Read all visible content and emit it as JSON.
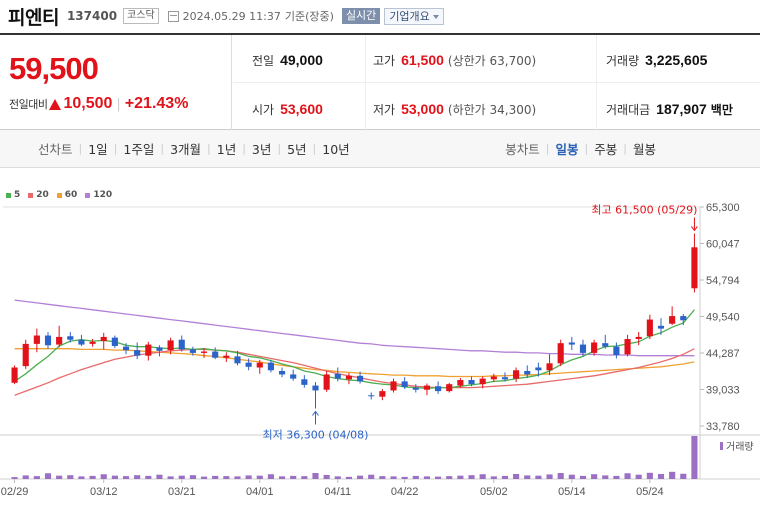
{
  "stock": {
    "name": "피엔티",
    "code": "137400",
    "market": "코스닥",
    "datetime": "2024.05.29 11:37",
    "basis": "기준(장중)",
    "realtime_label": "실시간",
    "company_info_label": "기업개요"
  },
  "summary": {
    "current_price": "59,500",
    "change_label": "전일대비",
    "change_value": "10,500",
    "change_pct": "+21.43%",
    "prev_close_label": "전일",
    "prev_close": "49,000",
    "open_label": "시가",
    "open": "53,600",
    "high_label": "고가",
    "high": "61,500",
    "upper_limit": "(상한가 63,700)",
    "low_label": "저가",
    "low": "53,000",
    "lower_limit": "(하한가 34,300)",
    "volume_label": "거래량",
    "volume": "3,225,605",
    "amount_label": "거래대금",
    "amount": "187,907",
    "amount_unit": "백만"
  },
  "periods": {
    "line_chart_label": "선차트",
    "items": [
      "1일",
      "1주일",
      "3개월",
      "1년",
      "3년",
      "5년",
      "10년"
    ],
    "candle_chart_label": "봉차트",
    "candle_items": [
      "일봉",
      "주봉",
      "월봉"
    ],
    "candle_selected": "일봉"
  },
  "colors": {
    "up": "#e2121a",
    "down": "#2b63c8",
    "ma5": "#4caf50",
    "ma20": "#e86a6a",
    "ma60": "#f0a030",
    "ma120": "#b380d8",
    "volume": "#9a6fc4"
  },
  "chart_data": {
    "type": "candlestick",
    "legend": [
      {
        "name": "5",
        "color": "#4caf50"
      },
      {
        "name": "20",
        "color": "#e86a6a"
      },
      {
        "name": "60",
        "color": "#f0a030"
      },
      {
        "name": "120",
        "color": "#b380d8"
      }
    ],
    "ylim": [
      33780,
      65300
    ],
    "y_ticks": [
      "65,300",
      "60,047",
      "54,794",
      "49,540",
      "44,287",
      "39,033",
      "33,780"
    ],
    "x_ticks": [
      {
        "label": "02/29",
        "index": 0
      },
      {
        "label": "03/12",
        "index": 8
      },
      {
        "label": "03/21",
        "index": 15
      },
      {
        "label": "04/01",
        "index": 22
      },
      {
        "label": "04/11",
        "index": 29
      },
      {
        "label": "04/22",
        "index": 35
      },
      {
        "label": "05/02",
        "index": 43
      },
      {
        "label": "05/14",
        "index": 50
      },
      {
        "label": "05/24",
        "index": 57
      }
    ],
    "annotation_high": "최고 61,500 (05/29)",
    "annotation_low": "최저 36,300 (04/08)",
    "volume_label": "거래량",
    "ohlc": [
      [
        40000,
        42500,
        39800,
        42200
      ],
      [
        42400,
        46200,
        42000,
        45600
      ],
      [
        45600,
        47800,
        44400,
        46800
      ],
      [
        46800,
        47300,
        44900,
        45400
      ],
      [
        45500,
        48200,
        45100,
        46600
      ],
      [
        46700,
        47300,
        45800,
        46200
      ],
      [
        46200,
        46900,
        45300,
        45500
      ],
      [
        45600,
        46300,
        45200,
        45900
      ],
      [
        46000,
        47200,
        44800,
        46600
      ],
      [
        46500,
        46800,
        45000,
        45300
      ],
      [
        45200,
        45700,
        44100,
        44700
      ],
      [
        44700,
        45800,
        43400,
        43900
      ],
      [
        43900,
        45900,
        43200,
        45500
      ],
      [
        45100,
        45400,
        43800,
        44600
      ],
      [
        44700,
        46500,
        44100,
        46100
      ],
      [
        46200,
        46800,
        44500,
        44800
      ],
      [
        44800,
        45200,
        43900,
        44300
      ],
      [
        44300,
        45000,
        43600,
        44500
      ],
      [
        44500,
        45100,
        43400,
        43600
      ],
      [
        43600,
        44400,
        43000,
        43900
      ],
      [
        43800,
        44600,
        42500,
        42800
      ],
      [
        42900,
        43500,
        41800,
        42300
      ],
      [
        42200,
        43300,
        41300,
        42900
      ],
      [
        42900,
        43300,
        41500,
        41800
      ],
      [
        41700,
        42200,
        40800,
        41200
      ],
      [
        41200,
        41900,
        40300,
        40600
      ],
      [
        40500,
        41100,
        39300,
        39700
      ],
      [
        39600,
        40100,
        36300,
        38900
      ],
      [
        39000,
        41700,
        38700,
        41200
      ],
      [
        41300,
        42200,
        40200,
        40600
      ],
      [
        40500,
        41400,
        39800,
        41000
      ],
      [
        41000,
        41600,
        39900,
        40200
      ],
      [
        38200,
        38600,
        37600,
        38100
      ],
      [
        38000,
        39100,
        37500,
        38800
      ],
      [
        38900,
        40600,
        38600,
        40200
      ],
      [
        40200,
        40800,
        39100,
        39400
      ],
      [
        39300,
        39800,
        38600,
        39000
      ],
      [
        39000,
        39900,
        38200,
        39600
      ],
      [
        39500,
        40200,
        38400,
        38800
      ],
      [
        38800,
        40000,
        38600,
        39800
      ],
      [
        39600,
        40700,
        39300,
        40400
      ],
      [
        40400,
        40900,
        39500,
        39800
      ],
      [
        39800,
        40900,
        39200,
        40600
      ],
      [
        40500,
        41300,
        40100,
        40900
      ],
      [
        40800,
        41500,
        40200,
        40500
      ],
      [
        40600,
        42200,
        40100,
        41800
      ],
      [
        41700,
        42500,
        40700,
        41200
      ],
      [
        42200,
        42900,
        40900,
        41800
      ],
      [
        41800,
        44100,
        41100,
        42800
      ],
      [
        42800,
        46200,
        42400,
        45700
      ],
      [
        45800,
        46600,
        44700,
        45500
      ],
      [
        45500,
        46200,
        43800,
        44300
      ],
      [
        44300,
        46200,
        43900,
        45800
      ],
      [
        45700,
        46900,
        44900,
        45200
      ],
      [
        45200,
        45800,
        43500,
        44000
      ],
      [
        44100,
        46900,
        43800,
        46300
      ],
      [
        46300,
        47300,
        45400,
        46600
      ],
      [
        46700,
        49800,
        46300,
        49100
      ],
      [
        48200,
        49300,
        46900,
        47800
      ],
      [
        48500,
        51000,
        48300,
        49600
      ],
      [
        49600,
        49900,
        48300,
        49000
      ],
      [
        53600,
        61500,
        53000,
        59500
      ]
    ],
    "ma5": [
      40200,
      41300,
      42600,
      43800,
      45300,
      46000,
      46200,
      46000,
      46100,
      45900,
      45400,
      45200,
      45200,
      45000,
      44900,
      45000,
      44800,
      44900,
      44700,
      44600,
      44300,
      43800,
      43600,
      43200,
      42700,
      42300,
      41700,
      41400,
      40900,
      40600,
      40400,
      40300,
      40000,
      39800,
      39700,
      39400,
      39300,
      39200,
      39300,
      39300,
      39500,
      39700,
      39900,
      40200,
      40300,
      40600,
      40800,
      41100,
      41700,
      42600,
      43300,
      43800,
      44600,
      45200,
      45300,
      45600,
      45900,
      46700,
      47200,
      48000,
      48600,
      50500
    ],
    "ma20": [
      38200,
      38800,
      39400,
      40000,
      40700,
      41300,
      41900,
      42400,
      42900,
      43400,
      43700,
      44000,
      44200,
      44400,
      44600,
      44700,
      44800,
      44800,
      44700,
      44600,
      44400,
      44100,
      43800,
      43500,
      43200,
      42900,
      42500,
      42100,
      41700,
      41300,
      41000,
      40700,
      40400,
      40100,
      39900,
      39700,
      39500,
      39400,
      39300,
      39300,
      39300,
      39300,
      39400,
      39500,
      39600,
      39700,
      39800,
      40000,
      40200,
      40400,
      40600,
      40800,
      41000,
      41300,
      41600,
      41900,
      42200,
      42600,
      43000,
      43500,
      44100,
      44900
    ],
    "ma60": [
      44900,
      44900,
      44900,
      44900,
      44900,
      44900,
      44800,
      44800,
      44800,
      44700,
      44700,
      44600,
      44500,
      44400,
      44300,
      44200,
      44100,
      43900,
      43800,
      43600,
      43400,
      43200,
      43000,
      42700,
      42500,
      42300,
      42100,
      41900,
      41800,
      41600,
      41500,
      41400,
      41300,
      41200,
      41100,
      41100,
      41000,
      41000,
      41000,
      40900,
      40900,
      40900,
      40900,
      41000,
      41000,
      41100,
      41100,
      41200,
      41300,
      41400,
      41500,
      41600,
      41700,
      41800,
      41900,
      42000,
      42100,
      42200,
      42300,
      42500,
      42700,
      43000
    ],
    "ma120": [
      51900,
      51700,
      51500,
      51300,
      51100,
      50900,
      50700,
      50500,
      50300,
      50100,
      49900,
      49700,
      49500,
      49300,
      49100,
      48900,
      48700,
      48500,
      48300,
      48100,
      47900,
      47700,
      47500,
      47300,
      47100,
      46900,
      46700,
      46500,
      46300,
      46100,
      45900,
      45700,
      45600,
      45400,
      45300,
      45200,
      45100,
      45000,
      44900,
      44800,
      44700,
      44600,
      44600,
      44500,
      44400,
      44400,
      44300,
      44300,
      44200,
      44200,
      44100,
      44100,
      44100,
      44000,
      44000,
      44000,
      43900,
      43900,
      43900,
      43900,
      43900,
      43900
    ],
    "volume": [
      80,
      150,
      120,
      240,
      140,
      160,
      110,
      130,
      200,
      140,
      120,
      160,
      130,
      180,
      110,
      140,
      160,
      100,
      130,
      120,
      110,
      150,
      140,
      200,
      110,
      130,
      120,
      250,
      170,
      110,
      90,
      140,
      180,
      120,
      110,
      90,
      130,
      110,
      100,
      120,
      140,
      160,
      200,
      110,
      130,
      210,
      150,
      140,
      190,
      250,
      180,
      130,
      200,
      150,
      130,
      240,
      180,
      260,
      210,
      300,
      220,
      1800
    ]
  }
}
